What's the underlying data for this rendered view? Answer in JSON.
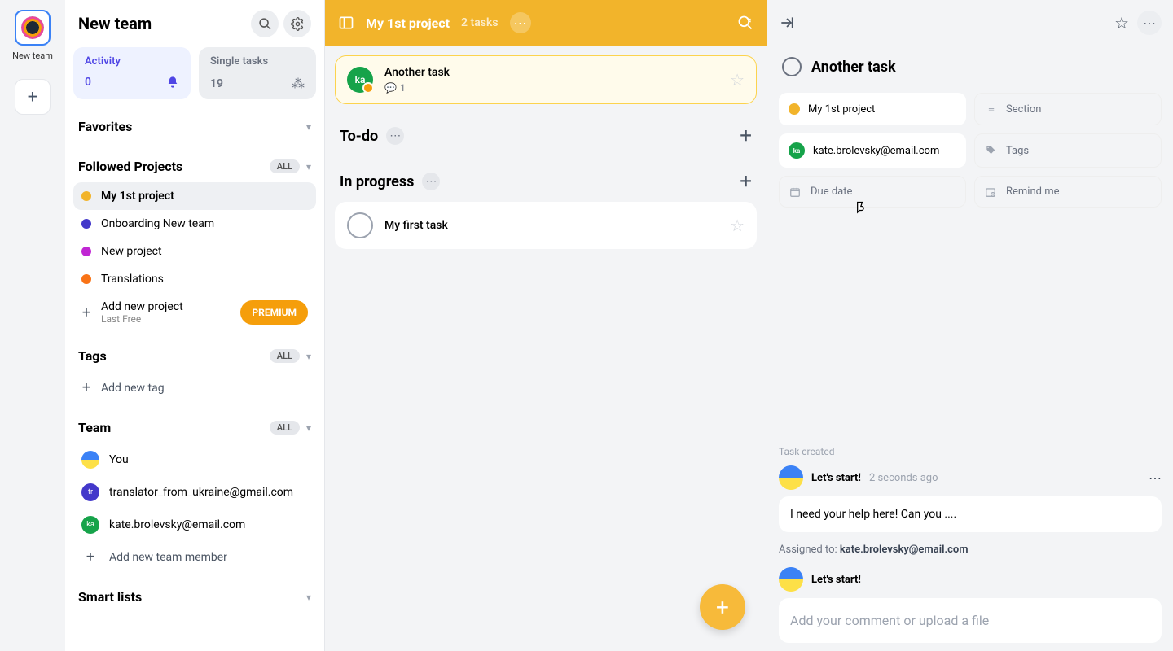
{
  "rail": {
    "team_label": "New team"
  },
  "sidebar": {
    "title": "New team",
    "cards": [
      {
        "title": "Activity",
        "count": "0"
      },
      {
        "title": "Single tasks",
        "count": "19"
      }
    ],
    "favorites_label": "Favorites",
    "followed_label": "Followed Projects",
    "all_label": "ALL",
    "projects": [
      {
        "name": "My 1st project",
        "color": "#f2b42b"
      },
      {
        "name": "Onboarding New team",
        "color": "#4338ca"
      },
      {
        "name": "New project",
        "color": "#c026d3"
      },
      {
        "name": "Translations",
        "color": "#f97316"
      }
    ],
    "add_project": "Add new project",
    "add_project_sub": "Last Free",
    "premium": "PREMIUM",
    "tags_label": "Tags",
    "add_tag": "Add new tag",
    "team_label": "Team",
    "members": [
      {
        "name": "You",
        "bg": "linear-gradient(#3b82f6 50%, #fde047 50%)",
        "initials": ""
      },
      {
        "name": "translator_from_ukraine@gmail.com",
        "bg": "#4338ca",
        "initials": "tr"
      },
      {
        "name": "kate.brolevsky@email.com",
        "bg": "#16a34a",
        "initials": "ka"
      }
    ],
    "add_member": "Add new team member",
    "smart_lists": "Smart lists"
  },
  "center": {
    "title": "My 1st project",
    "subtitle": "2 tasks",
    "tasks": [
      {
        "name": "Another task",
        "comments": "1",
        "assignee_initials": "ka"
      }
    ],
    "groups": [
      {
        "title": "To-do"
      },
      {
        "title": "In progress"
      }
    ],
    "other_task": "My first task"
  },
  "detail": {
    "title": "Another task",
    "fields": {
      "project": "My 1st project",
      "section": "Section",
      "assignee": "kate.brolevsky@email.com",
      "tags": "Tags",
      "due": "Due date",
      "remind": "Remind me"
    },
    "activity": {
      "created_label": "Task created",
      "author": "Let's start!",
      "time": "2 seconds ago",
      "comment": "I need your help here! Can you ....",
      "assigned_prefix": "Assigned to: ",
      "assigned_to": "kate.brolevsky@email.com",
      "author2": "Let's start!",
      "input_placeholder": "Add your comment or upload a file"
    }
  }
}
